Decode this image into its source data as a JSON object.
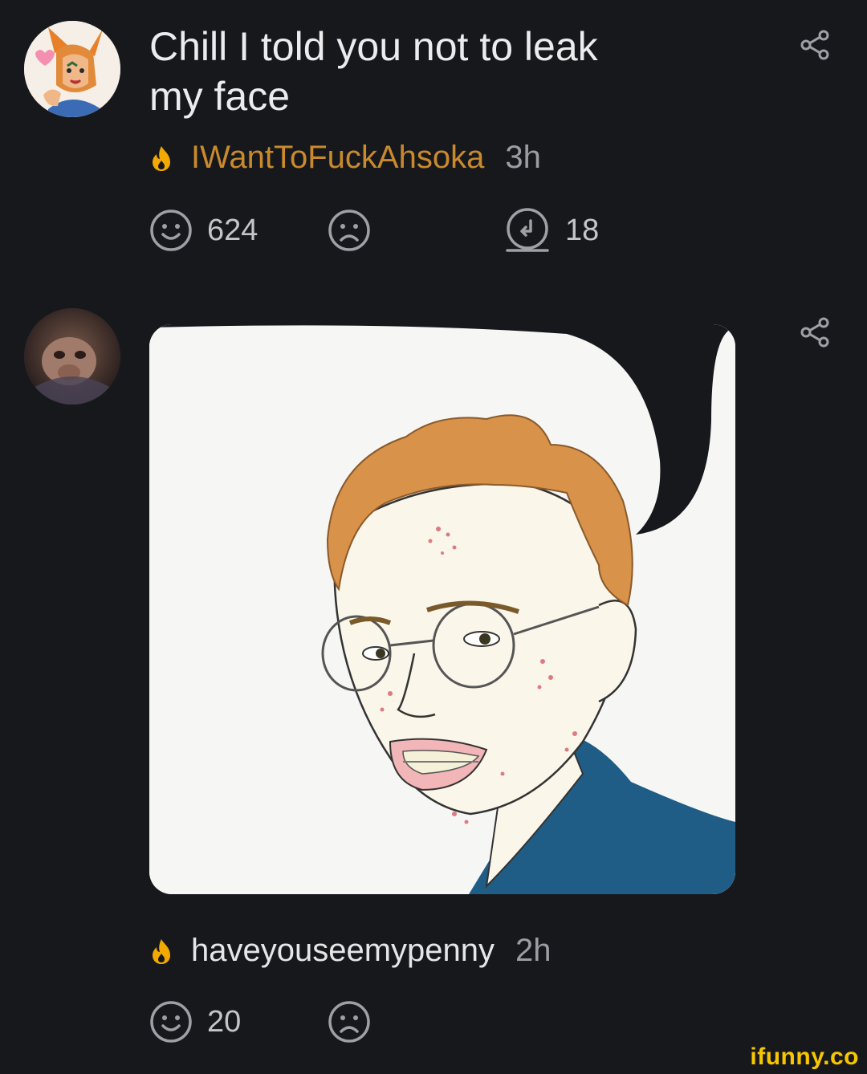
{
  "comments": [
    {
      "text_line1": "Chill I told you not to leak",
      "text_line2": "my face",
      "username": "IWantToFuckAhsoka",
      "time": "3h",
      "likes": "624",
      "replies": "18"
    },
    {
      "username": "haveyouseemypenny",
      "time": "2h",
      "likes": "20"
    }
  ],
  "watermark": "ifunny.co",
  "colors": {
    "background": "#17181c",
    "username_gold": "#c98a2e",
    "fire": "#f2a900",
    "icons": "#9fa0a5"
  },
  "icons": [
    "share-icon",
    "smile-icon",
    "frown-icon",
    "reply-icon",
    "fire-icon"
  ]
}
